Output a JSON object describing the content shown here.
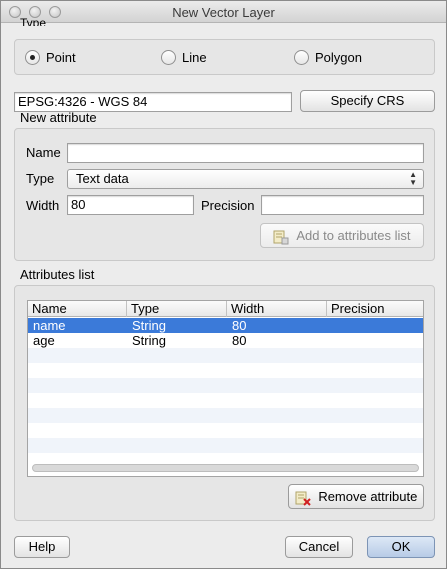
{
  "window": {
    "title": "New Vector Layer"
  },
  "type_group": {
    "label": "Type",
    "options": [
      {
        "label": "Point",
        "checked": true
      },
      {
        "label": "Line",
        "checked": false
      },
      {
        "label": "Polygon",
        "checked": false
      }
    ]
  },
  "crs": {
    "value": "EPSG:4326 - WGS 84",
    "button": "Specify CRS"
  },
  "new_attribute": {
    "label": "New attribute",
    "name_label": "Name",
    "name_value": "",
    "type_label": "Type",
    "type_value": "Text data",
    "width_label": "Width",
    "width_value": "80",
    "precision_label": "Precision",
    "precision_value": "",
    "add_button": "Add to attributes list"
  },
  "attributes": {
    "label": "Attributes list",
    "columns": [
      "Name",
      "Type",
      "Width",
      "Precision"
    ],
    "rows": [
      {
        "name": "name",
        "type": "String",
        "width": "80",
        "precision": "",
        "selected": true
      },
      {
        "name": "age",
        "type": "String",
        "width": "80",
        "precision": "",
        "selected": false
      }
    ],
    "remove_button": "Remove attribute"
  },
  "footer": {
    "help": "Help",
    "cancel": "Cancel",
    "ok": "OK"
  },
  "colors": {
    "selection": "#3b7ad9",
    "window_bg": "#ececec"
  },
  "icons": [
    "add-attribute-icon",
    "remove-attribute-icon"
  ]
}
